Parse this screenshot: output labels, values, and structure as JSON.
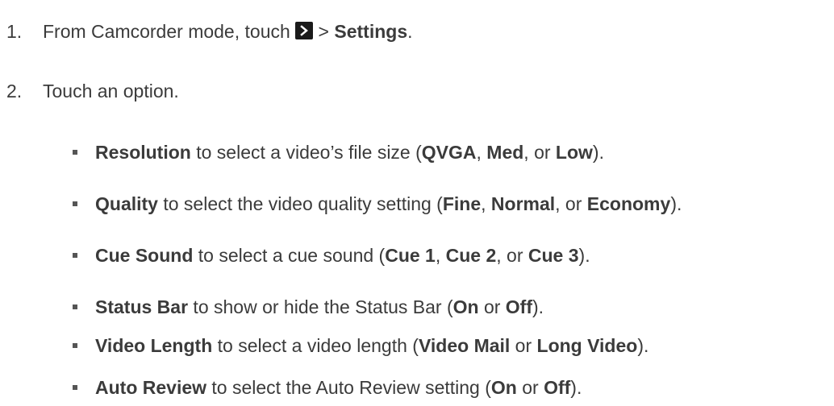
{
  "steps": [
    {
      "number": "1.",
      "prefix": "From Camcorder mode, touch",
      "icon": "chevron-right-icon",
      "middle": " > ",
      "bold": "Settings",
      "suffix": "."
    },
    {
      "number": "2.",
      "text": "Touch an option."
    }
  ],
  "options": [
    {
      "name": "Resolution",
      "t1": " to select a video’s file size (",
      "v1": "QVGA",
      "s1": ", ",
      "v2": "Med",
      "s2": ", or ",
      "v3": "Low",
      "end": ")."
    },
    {
      "name": "Quality",
      "t1": " to select the video quality setting (",
      "v1": "Fine",
      "s1": ", ",
      "v2": "Normal",
      "s2": ", or ",
      "v3": "Economy",
      "end": ")."
    },
    {
      "name": "Cue Sound",
      "t1": " to select a cue sound (",
      "v1": "Cue 1",
      "s1": ", ",
      "v2": "Cue 2",
      "s2": ", or ",
      "v3": "Cue 3",
      "end": ")."
    },
    {
      "name": "Status Bar",
      "t1": " to show or hide the Status Bar (",
      "v1": "On",
      "s1": " or ",
      "v2": "Off",
      "end": ")."
    },
    {
      "name": "Video Length",
      "t1": " to select a video length (",
      "v1": "Video Mail",
      "s1": " or ",
      "v2": "Long Video",
      "end": ")."
    },
    {
      "name": "Auto Review",
      "t1": " to select the Auto Review setting (",
      "v1": "On",
      "s1": " or ",
      "v2": "Off",
      "end": ")."
    }
  ]
}
